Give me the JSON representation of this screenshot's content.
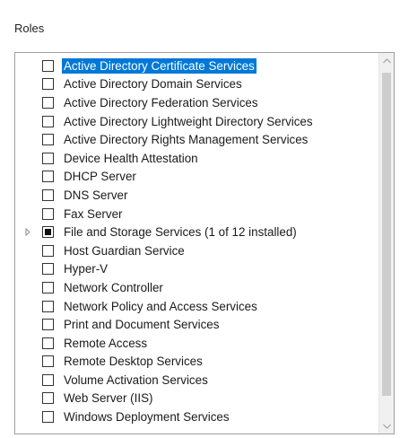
{
  "section": {
    "title": "Roles"
  },
  "roles": [
    {
      "label": "Active Directory Certificate Services",
      "checked": false,
      "expandable": false,
      "selected": true
    },
    {
      "label": "Active Directory Domain Services",
      "checked": false,
      "expandable": false,
      "selected": false
    },
    {
      "label": "Active Directory Federation Services",
      "checked": false,
      "expandable": false,
      "selected": false
    },
    {
      "label": "Active Directory Lightweight Directory Services",
      "checked": false,
      "expandable": false,
      "selected": false
    },
    {
      "label": "Active Directory Rights Management Services",
      "checked": false,
      "expandable": false,
      "selected": false
    },
    {
      "label": "Device Health Attestation",
      "checked": false,
      "expandable": false,
      "selected": false
    },
    {
      "label": "DHCP Server",
      "checked": false,
      "expandable": false,
      "selected": false
    },
    {
      "label": "DNS Server",
      "checked": false,
      "expandable": false,
      "selected": false
    },
    {
      "label": "Fax Server",
      "checked": false,
      "expandable": false,
      "selected": false
    },
    {
      "label": "File and Storage Services (1 of 12 installed)",
      "checked": "partial",
      "expandable": true,
      "selected": false
    },
    {
      "label": "Host Guardian Service",
      "checked": false,
      "expandable": false,
      "selected": false
    },
    {
      "label": "Hyper-V",
      "checked": false,
      "expandable": false,
      "selected": false
    },
    {
      "label": "Network Controller",
      "checked": false,
      "expandable": false,
      "selected": false
    },
    {
      "label": "Network Policy and Access Services",
      "checked": false,
      "expandable": false,
      "selected": false
    },
    {
      "label": "Print and Document Services",
      "checked": false,
      "expandable": false,
      "selected": false
    },
    {
      "label": "Remote Access",
      "checked": false,
      "expandable": false,
      "selected": false
    },
    {
      "label": "Remote Desktop Services",
      "checked": false,
      "expandable": false,
      "selected": false
    },
    {
      "label": "Volume Activation Services",
      "checked": false,
      "expandable": false,
      "selected": false
    },
    {
      "label": "Web Server (IIS)",
      "checked": false,
      "expandable": false,
      "selected": false
    },
    {
      "label": "Windows Deployment Services",
      "checked": false,
      "expandable": false,
      "selected": false
    }
  ],
  "scrollbar": {
    "up_icon": "chevron-up-icon",
    "down_icon": "chevron-down-icon"
  },
  "colors": {
    "selection": "#0078d7",
    "border": "#a0a0a0"
  }
}
